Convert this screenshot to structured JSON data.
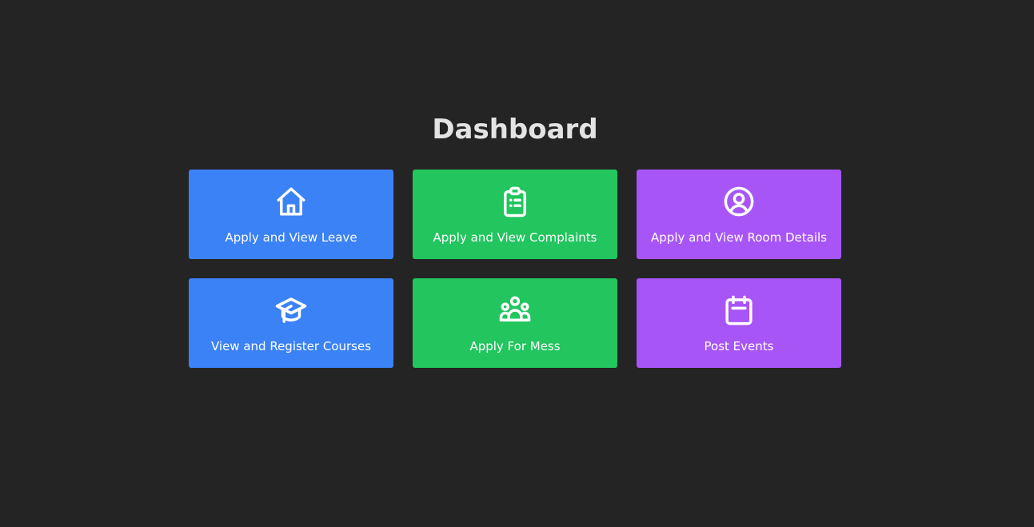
{
  "dashboard": {
    "title": "Dashboard",
    "cards": [
      {
        "label": "Apply and View Leave",
        "icon": "home-icon",
        "color": "#3b82f6"
      },
      {
        "label": "Apply and View Complaints",
        "icon": "clipboard-list-icon",
        "color": "#22c55e"
      },
      {
        "label": "Apply and View Room Details",
        "icon": "user-circle-icon",
        "color": "#a855f7"
      },
      {
        "label": "View and Register Courses",
        "icon": "graduation-cap-icon",
        "color": "#3b82f6"
      },
      {
        "label": "Apply For Mess",
        "icon": "users-group-icon",
        "color": "#22c55e"
      },
      {
        "label": "Post Events",
        "icon": "calendar-icon",
        "color": "#a855f7"
      }
    ]
  }
}
